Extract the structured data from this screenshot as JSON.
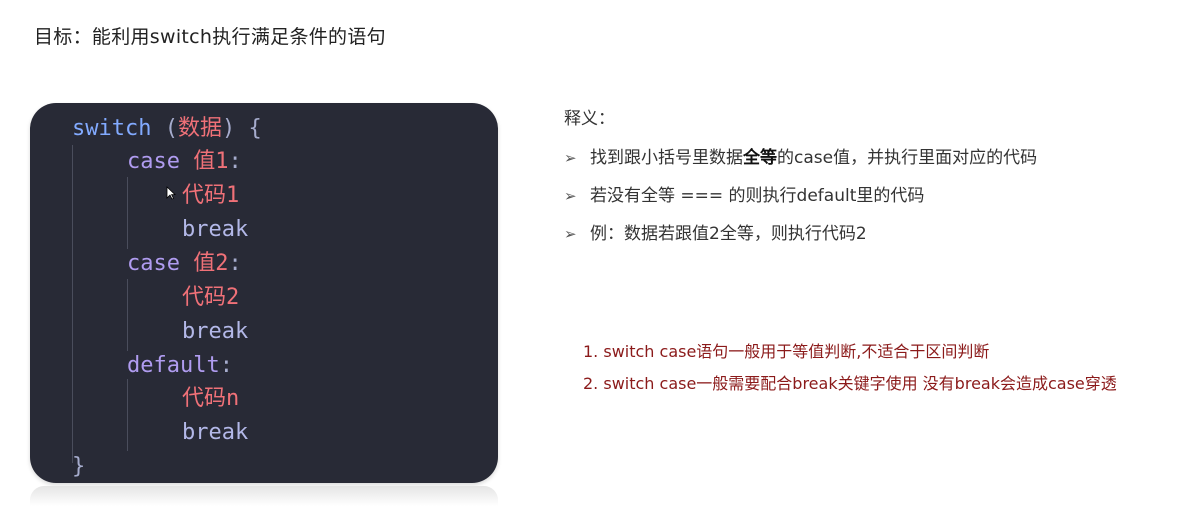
{
  "title": "目标：能利用switch执行满足条件的语句",
  "code": {
    "line1": {
      "kw": "switch",
      "open": " (",
      "name": "数据",
      "close": ") {"
    },
    "case1": {
      "kw": "case",
      "value": "值1",
      "colon": ":"
    },
    "code1": "代码1",
    "break1": "break",
    "case2": {
      "kw": "case",
      "value": "值2",
      "colon": ":"
    },
    "code2": "代码2",
    "break2": "break",
    "default": {
      "kw": "default",
      "colon": ":"
    },
    "coden": "代码n",
    "break3": "break",
    "end": "}"
  },
  "explain": {
    "label": "释义：",
    "bullets": [
      {
        "pre": "找到跟小括号里数据",
        "bold": "全等",
        "post": "的case值，并执行里面对应的代码"
      },
      {
        "text": "若没有全等 === 的则执行default里的代码"
      },
      {
        "text": "例：数据若跟值2全等，则执行代码2"
      }
    ],
    "arrow": "➢"
  },
  "notes": [
    "1. switch case语句一般用于等值判断,不适合于区间判断",
    "2. switch case一般需要配合break关键字使用 没有break会造成case穿透"
  ],
  "colors": {
    "code_bg": "#282a36",
    "keyword": "#c792ea",
    "chinese_value": "#f07178",
    "note_text": "#8b1a1a"
  }
}
